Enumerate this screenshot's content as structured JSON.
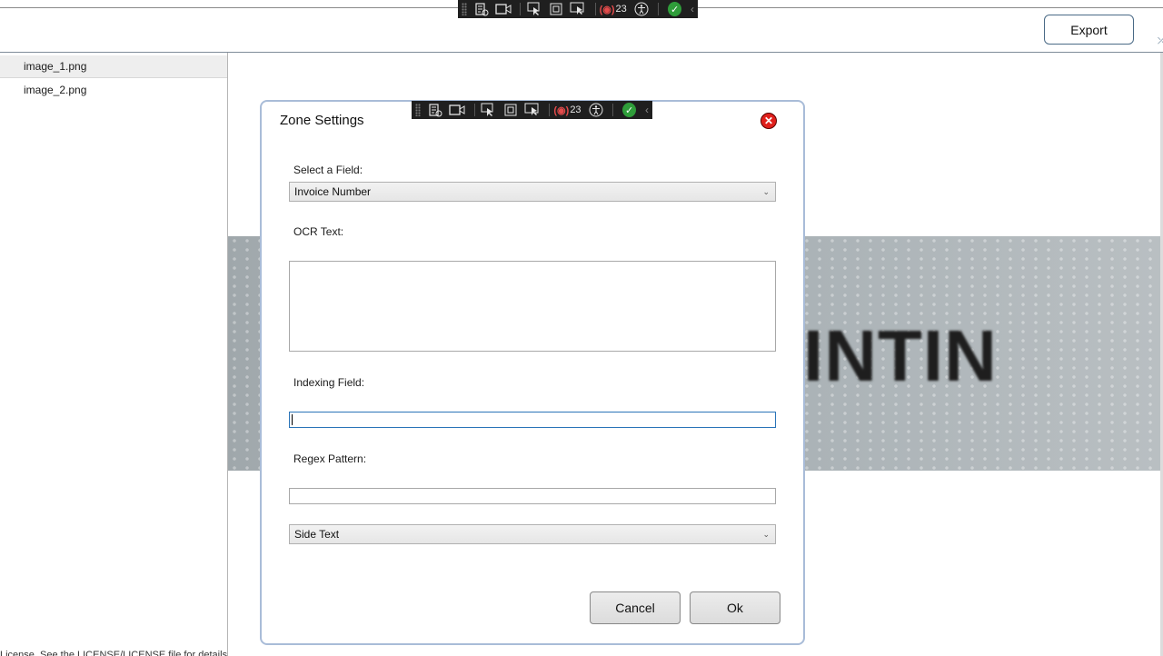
{
  "header": {
    "export_label": "Export"
  },
  "sidebar": {
    "files": [
      {
        "name": "image_1.png",
        "selected": true
      },
      {
        "name": "image_2.png",
        "selected": false
      }
    ]
  },
  "viewer": {
    "ocr_word": "INTIN"
  },
  "footer": {
    "license_text": "License. See the LICENSE/LICENSE file for details"
  },
  "devtoolbar": {
    "binding_errors": "23"
  },
  "dialog": {
    "title": "Zone Settings",
    "field_label": "Select a Field:",
    "field_value": "Invoice Number",
    "ocr_label": "OCR Text:",
    "ocr_value": "",
    "indexing_label": "Indexing Field:",
    "indexing_value": "",
    "regex_label": "Regex Pattern:",
    "regex_value": "",
    "position_value": "Side Text",
    "cancel_label": "Cancel",
    "ok_label": "Ok"
  }
}
